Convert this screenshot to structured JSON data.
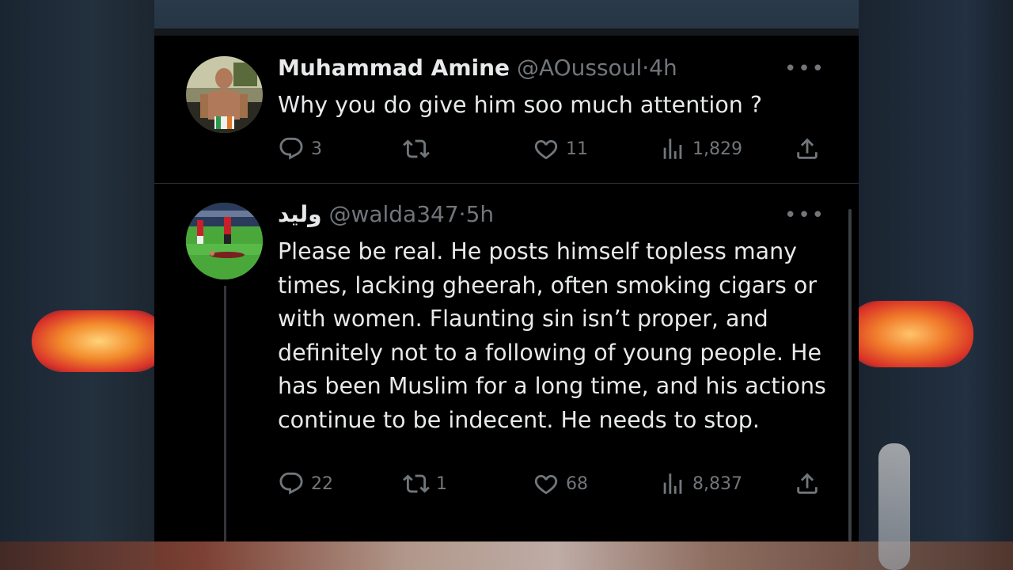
{
  "tweets": [
    {
      "name": "Muhammad Amine",
      "handle": "@AOussoul",
      "dot": "·",
      "time": "4h",
      "more": "•••",
      "text": "Why you do give him soo much attention ?",
      "replies": "3",
      "retweets": "",
      "likes": "11",
      "views": "1,829"
    },
    {
      "name": "وليد",
      "handle": "@walda347",
      "dot": "·",
      "time": "5h",
      "more": "•••",
      "text": "Please be real. He posts himself topless many times, lacking gheerah, often smoking cigars or with women. Flaunting sin isn’t proper, and definitely not to a following of young people. He has been Muslim for a long time, and his actions continue to be indecent. He needs to stop.",
      "replies": "22",
      "retweets": "1",
      "likes": "68",
      "views": "8,837"
    }
  ],
  "icons": {
    "reply": "reply-icon",
    "retweet": "retweet-icon",
    "like": "heart-icon",
    "views": "views-icon",
    "share": "share-icon"
  },
  "colors": {
    "background": "#000000",
    "text": "#e7e9ea",
    "secondary": "#71767b",
    "divider": "#2f3336"
  }
}
